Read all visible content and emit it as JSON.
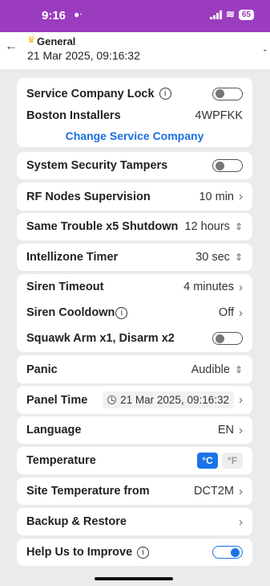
{
  "status": {
    "time": "9:16",
    "battery": "65"
  },
  "header": {
    "title": "General",
    "subtitle": "21 Mar 2025, 09:16:32",
    "trailing": "-"
  },
  "service": {
    "lock_label": "Service Company Lock",
    "company_name": "Boston Installers",
    "company_code": "4WPFKK",
    "change_label": "Change Service Company"
  },
  "tampers": {
    "label": "System Security Tampers"
  },
  "rf_nodes": {
    "label": "RF Nodes Supervision",
    "value": "10 min"
  },
  "trouble": {
    "label": "Same Trouble x5 Shutdown",
    "value": "12 hours"
  },
  "intellizone": {
    "label": "Intellizone Timer",
    "value": "30 sec"
  },
  "siren": {
    "timeout_label": "Siren Timeout",
    "timeout_value": "4 minutes",
    "cooldown_label": "Siren Cooldown",
    "cooldown_value": "Off",
    "squawk_label": "Squawk Arm x1, Disarm x2"
  },
  "panic": {
    "label": "Panic",
    "value": "Audible"
  },
  "panel_time": {
    "label": "Panel Time",
    "value": "21 Mar 2025, 09:16:32"
  },
  "language": {
    "label": "Language",
    "value": "EN"
  },
  "temperature": {
    "label": "Temperature",
    "celsius": "°C",
    "fahrenheit": "°F",
    "selected": "°C"
  },
  "site_temp": {
    "label": "Site Temperature from",
    "value": "DCT2M"
  },
  "backup": {
    "label": "Backup & Restore"
  },
  "help": {
    "label": "Help Us to Improve"
  },
  "colors": {
    "accent": "#9b3cbf",
    "link": "#1a6fe0",
    "toggle_on": "#1a73e8"
  }
}
